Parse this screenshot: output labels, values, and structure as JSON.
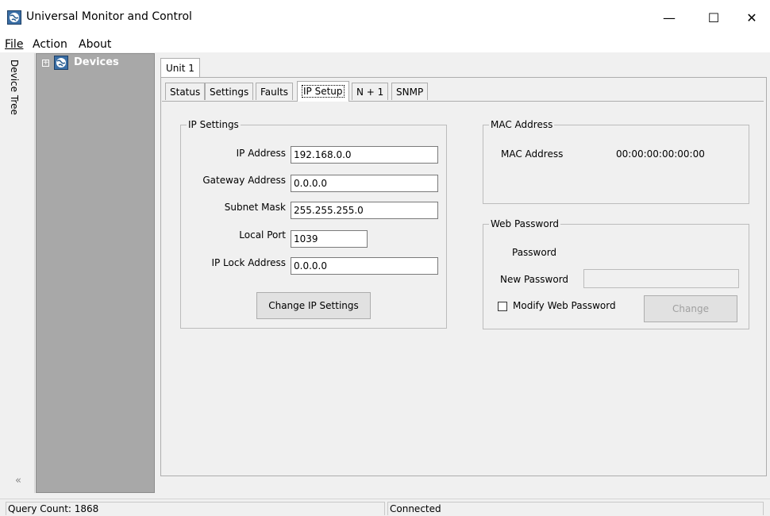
{
  "window": {
    "title": "Universal Monitor and Control",
    "controls": {
      "minimize": "—",
      "maximize": "☐",
      "close": "✕"
    }
  },
  "menu": [
    {
      "label": "File",
      "mnemonic": "F"
    },
    {
      "label": "Action",
      "mnemonic": "A"
    },
    {
      "label": "About",
      "mnemonic": "A"
    }
  ],
  "sidebar": {
    "strip_label": "Device Tree",
    "collapse_glyph": "«",
    "tree": {
      "expander": "+",
      "node_label": "Devices",
      "icon": "globe-icon"
    }
  },
  "unit_tab": "Unit 1",
  "tabs": [
    "Status",
    "Settings",
    "Faults",
    "IP Setup",
    "N + 1",
    "SNMP"
  ],
  "active_tab": "IP Setup",
  "ip_settings": {
    "title": "IP Settings",
    "fields": [
      {
        "label": "IP Address",
        "value": "192.168.0.0"
      },
      {
        "label": "Gateway Address",
        "value": "0.0.0.0"
      },
      {
        "label": "Subnet Mask",
        "value": "255.255.255.0"
      },
      {
        "label": "Local Port",
        "value": "1039"
      },
      {
        "label": "IP Lock Address",
        "value": "0.0.0.0"
      }
    ],
    "button": "Change IP Settings"
  },
  "mac_address": {
    "title": "MAC Address",
    "label": "MAC Address",
    "value": "00:00:00:00:00:00"
  },
  "web_password": {
    "title": "Web Password",
    "password_label": "Password",
    "new_password_label": "New Password",
    "new_password_value": "",
    "checkbox_label": "Modify Web Password",
    "checkbox_checked": false,
    "button": "Change"
  },
  "status_bar": {
    "query_count": "Query Count: 1868",
    "connection": "Connected"
  }
}
